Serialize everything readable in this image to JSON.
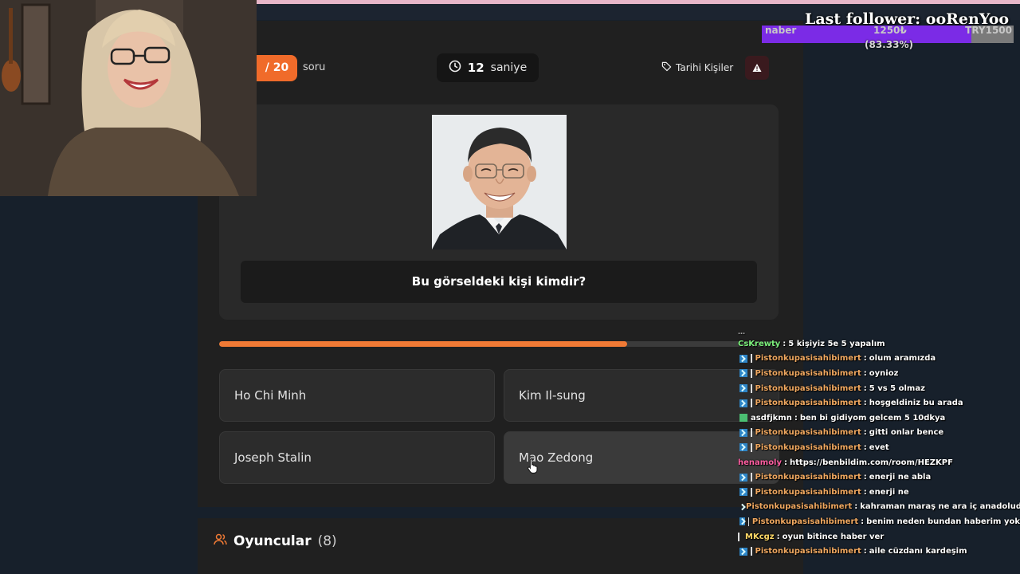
{
  "quiz": {
    "question_counter": "/ 20",
    "question_label": "soru",
    "timer_value": "12",
    "timer_unit": "saniye",
    "category": "Tarihi Kişiler",
    "question": "Bu görseldeki kişi kimdir?",
    "progress_fraction": 0.73,
    "options": [
      "Ho Chi Minh",
      "Kim Il-sung",
      "Joseph Stalin",
      "Mao Zedong"
    ],
    "hovered_option": "Mao Zedong"
  },
  "players": {
    "title": "Oyuncular",
    "count": "(8)"
  },
  "overlay": {
    "last_follower": "Last follower: ooRenYoo",
    "goal_left": "naber",
    "goal_mid": "1250₺",
    "goal_right": "TRY1500",
    "goal_percent": "(83.33%)",
    "goal_fraction": 0.8333
  },
  "chat": {
    "partial_top": "…",
    "messages": [
      {
        "badge": "none",
        "user": "CsKrewty",
        "color": "#7cf07c",
        "text": "5 kişiyiz 5e 5 yapalım"
      },
      {
        "badge": "prime",
        "user": "Pistonkupasisahibimert",
        "color": "#f0a860",
        "text": "olum aramızda"
      },
      {
        "badge": "prime",
        "user": "Pistonkupasisahibimert",
        "color": "#f0a860",
        "text": "oynioz"
      },
      {
        "badge": "prime",
        "user": "Pistonkupasisahibimert",
        "color": "#f0a860",
        "text": "5 vs 5 olmaz"
      },
      {
        "badge": "prime",
        "user": "Pistonkupasisahibimert",
        "color": "#f0a860",
        "text": "hoşgeldiniz bu arada"
      },
      {
        "badge": "green",
        "user": "asdfjkmn",
        "color": "#ffffff",
        "text": "ben bi gidiyom gelcem 5 10dkya"
      },
      {
        "badge": "prime",
        "user": "Pistonkupasisahibimert",
        "color": "#f0a860",
        "text": "gitti onlar bence"
      },
      {
        "badge": "prime",
        "user": "Pistonkupasisahibimert",
        "color": "#f0a860",
        "text": "evet"
      },
      {
        "badge": "none",
        "user": "henamoly",
        "color": "#ff5fa2",
        "text": "https://benbildim.com/room/HEZKPF"
      },
      {
        "badge": "prime",
        "user": "Pistonkupasisahibimert",
        "color": "#f0a860",
        "text": "enerji ne abla"
      },
      {
        "badge": "prime",
        "user": "Pistonkupasisahibimert",
        "color": "#f0a860",
        "text": "enerji ne"
      },
      {
        "badge": "prime",
        "user": "Pistonkupasisahibimert",
        "color": "#f0a860",
        "text": "kahraman maraş ne ara iç anadoluda amk"
      },
      {
        "badge": "prime",
        "user": "Pistonkupasisahibimert",
        "color": "#f0a860",
        "text": "benim neden bundan haberim yok"
      },
      {
        "badge": "bar",
        "user": "MKcgz",
        "color": "#ffd966",
        "text": "oyun bitince haber ver"
      },
      {
        "badge": "prime",
        "user": "Pistonkupasisahibimert",
        "color": "#f0a860",
        "text": "aile cüzdanı kardeşim"
      }
    ]
  },
  "colors": {
    "accent": "#f06b2a",
    "panel": "#202020",
    "card": "#292929",
    "goal_fill": "#7b2be6"
  }
}
